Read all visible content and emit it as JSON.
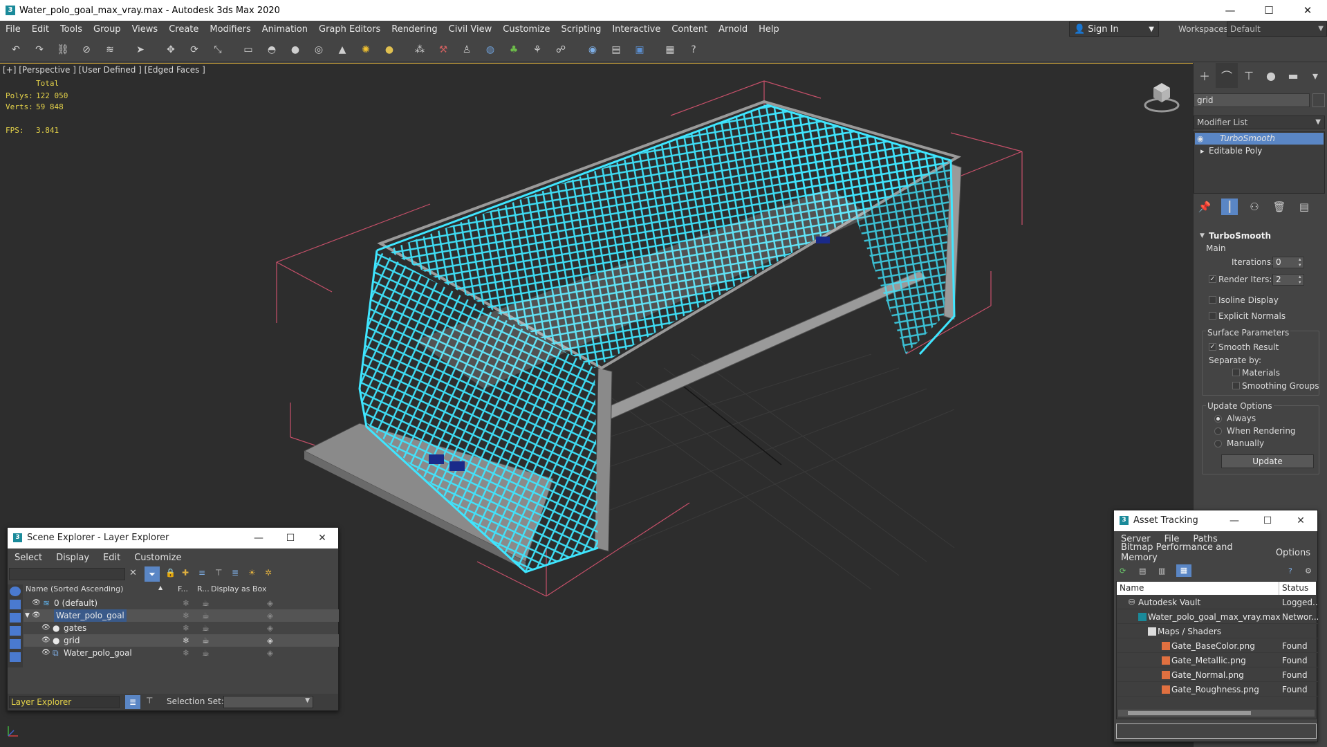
{
  "window": {
    "title": "Water_polo_goal_max_vray.max - Autodesk 3ds Max 2020",
    "minimize": "—",
    "maximize": "☐",
    "close": "✕"
  },
  "menu": [
    "File",
    "Edit",
    "Tools",
    "Group",
    "Views",
    "Create",
    "Modifiers",
    "Animation",
    "Graph Editors",
    "Rendering",
    "Civil View",
    "Customize",
    "Scripting",
    "Interactive",
    "Content",
    "Arnold",
    "Help"
  ],
  "account": {
    "sign_in": "Sign In",
    "workspaces_label": "Workspaces:",
    "workspace_value": "Default"
  },
  "viewport": {
    "label": "[+] [Perspective ] [User Defined ] [Edged Faces ]",
    "stats": {
      "total_label": "Total",
      "polys_label": "Polys:",
      "polys_value": "122 050",
      "verts_label": "Verts:",
      "verts_value": "59 848",
      "fps_label": "FPS:",
      "fps_value": "3.841"
    }
  },
  "command_panel": {
    "object_name": "grid",
    "modifier_list": "Modifier List",
    "stack": [
      "TurboSmooth",
      "Editable Poly"
    ],
    "turbosmooth": {
      "title": "TurboSmooth",
      "main": "Main",
      "iterations_label": "Iterations:",
      "iterations_value": "0",
      "render_iters_label": "Render Iters:",
      "render_iters_value": "2",
      "isoline": "Isoline Display",
      "explicit_normals": "Explicit Normals",
      "surface_params": "Surface Parameters",
      "smooth_result": "Smooth Result",
      "separate_by": "Separate by:",
      "materials": "Materials",
      "smoothing_groups": "Smoothing Groups",
      "update_options": "Update Options",
      "always": "Always",
      "when_rendering": "When Rendering",
      "manually": "Manually",
      "update_button": "Update"
    }
  },
  "scene_explorer": {
    "title": "Scene Explorer - Layer Explorer",
    "menu": [
      "Select",
      "Display",
      "Edit",
      "Customize"
    ],
    "columns": {
      "name": "Name (Sorted Ascending)",
      "freeze": "F...",
      "render": "R...",
      "box": "Display as Box"
    },
    "rows": [
      {
        "name": "0 (default)"
      },
      {
        "name": "Water_polo_goal"
      },
      {
        "name": "gates"
      },
      {
        "name": "grid"
      },
      {
        "name": "Water_polo_goal"
      }
    ],
    "footer_mode": "Layer Explorer",
    "selection_set_label": "Selection Set:"
  },
  "asset_tracking": {
    "title": "Asset Tracking",
    "menu1": [
      "Server",
      "File",
      "Paths"
    ],
    "menu2": [
      "Bitmap Performance and Memory",
      "Options"
    ],
    "columns": {
      "name": "Name",
      "status": "Status"
    },
    "rows": [
      {
        "name": "Autodesk Vault",
        "status": "Logged..."
      },
      {
        "name": "Water_polo_goal_max_vray.max",
        "status": "Networ..."
      },
      {
        "name": "Maps / Shaders",
        "status": ""
      },
      {
        "name": "Gate_BaseColor.png",
        "status": "Found"
      },
      {
        "name": "Gate_Metallic.png",
        "status": "Found"
      },
      {
        "name": "Gate_Normal.png",
        "status": "Found"
      },
      {
        "name": "Gate_Roughness.png",
        "status": "Found"
      }
    ]
  },
  "colors": {
    "accent_selection": "#5a86c5",
    "wire_highlight": "#3fe6ff",
    "stats_yellow": "#e6d44a",
    "bbox_pink": "#c8506a"
  }
}
